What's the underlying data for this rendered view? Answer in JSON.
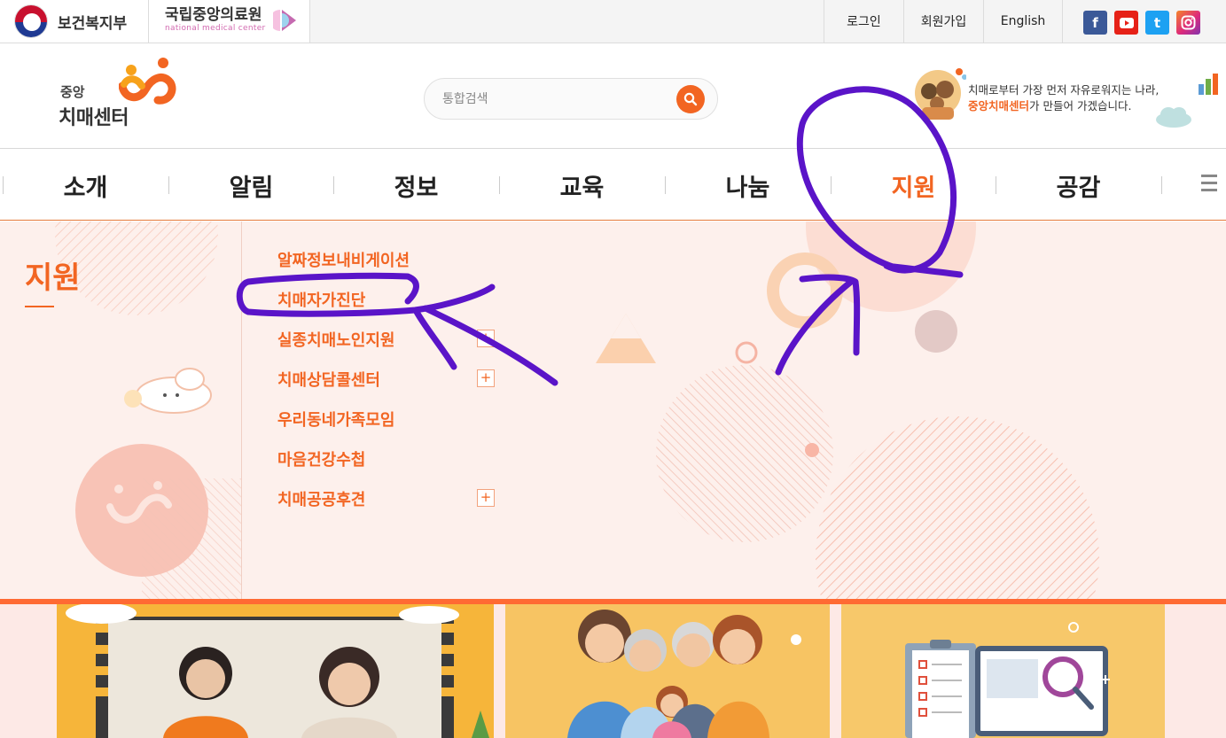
{
  "topbar": {
    "gov_name": "보건복지부",
    "nmc_name": "국립중앙의료원",
    "nmc_sub": "national medical center",
    "login": "로그인",
    "signup": "회원가입",
    "english": "English",
    "sns": [
      "facebook-icon",
      "youtube-icon",
      "twitter-icon",
      "instagram-icon"
    ]
  },
  "header": {
    "logo_small": "중앙",
    "logo_big": "치매센터",
    "search_placeholder": "통합검색",
    "promo_line1": "치매로부터 가장 먼저 자유로워지는 나라,",
    "promo_highlight": "중앙치매센터",
    "promo_line2_rest": "가 만들어 가겠습니다."
  },
  "gnb": {
    "items": [
      {
        "label": "소개",
        "active": false
      },
      {
        "label": "알림",
        "active": false
      },
      {
        "label": "정보",
        "active": false
      },
      {
        "label": "교육",
        "active": false
      },
      {
        "label": "나눔",
        "active": false
      },
      {
        "label": "지원",
        "active": true
      },
      {
        "label": "공감",
        "active": false
      }
    ]
  },
  "submenu": {
    "section_title": "지원",
    "items": [
      {
        "label": "알짜정보내비게이션",
        "expandable": false
      },
      {
        "label": "치매자가진단",
        "expandable": false
      },
      {
        "label": "실종치매노인지원",
        "expandable": true
      },
      {
        "label": "치매상담콜센터",
        "expandable": true
      },
      {
        "label": "우리동네가족모임",
        "expandable": false
      },
      {
        "label": "마음건강수첩",
        "expandable": false
      },
      {
        "label": "치매공공후견",
        "expandable": true
      }
    ],
    "plus_symbol": "+"
  },
  "colors": {
    "accent": "#f26522",
    "panel_bg": "#fdf0ec",
    "annotation": "#5a14c8"
  }
}
